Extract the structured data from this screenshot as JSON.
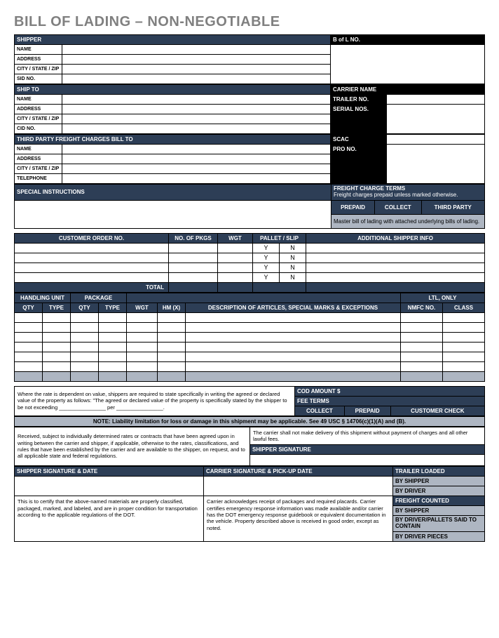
{
  "title": "BILL OF LADING – NON-NEGOTIABLE",
  "sections": {
    "shipper": {
      "header": "SHIPPER",
      "name": "NAME",
      "address": "ADDRESS",
      "csz": "CITY / STATE / ZIP",
      "sid": "SID NO."
    },
    "bol": {
      "header": "B of L NO."
    },
    "shipto": {
      "header": "SHIP TO",
      "name": "NAME",
      "address": "ADDRESS",
      "csz": "CITY / STATE / ZIP",
      "cid": "CID NO."
    },
    "carrier": {
      "name": "CARRIER NAME",
      "trailer": "TRAILER NO.",
      "serial": "SERIAL NOS."
    },
    "third": {
      "header": "THIRD PARTY FREIGHT CHARGES BILL TO",
      "name": "NAME",
      "address": "ADDRESS",
      "csz": "CITY / STATE / ZIP",
      "tel": "TELEPHONE"
    },
    "scac": "SCAC",
    "pro": "PRO NO.",
    "special": "SPECIAL INSTRUCTIONS",
    "freight": {
      "header": "FREIGHT CHARGE TERMS",
      "sub": "Freight charges prepaid unless marked otherwise.",
      "prepaid": "PREPAID",
      "collect": "COLLECT",
      "thirdparty": "THIRD PARTY",
      "master": "Master bill of lading with attached underlying bills of lading."
    }
  },
  "orderTable": {
    "custOrder": "CUSTOMER ORDER NO.",
    "pkgs": "NO. OF PKGS",
    "wgt": "WGT",
    "pallet": "PALLET / SLIP",
    "addl": "ADDITIONAL SHIPPER INFO",
    "y": "Y",
    "n": "N",
    "total": "TOTAL"
  },
  "handlingTable": {
    "hu": "HANDLING UNIT",
    "pkg": "PACKAGE",
    "ltl": "LTL, ONLY",
    "qty": "QTY",
    "type": "TYPE",
    "wgt": "WGT",
    "hm": "HM (X)",
    "desc": "DESCRIPTION OF ARTICLES, SPECIAL MARKS & EXCEPTIONS",
    "nmfc": "NMFC NO.",
    "class": "CLASS"
  },
  "valueNote": "Where the rate is dependent on value, shippers are required to state specifically in writing the agreed or declared value of the property as follows: \"The agreed or declared value of the property is specifically stated by the shipper to be not exceeding ________________ per ________________.",
  "cod": {
    "amount": "COD AMOUNT $",
    "feeTerms": "FEE TERMS",
    "collect": "COLLECT",
    "prepaid": "PREPAID",
    "check": "CUSTOMER CHECK"
  },
  "liability": "NOTE: Liability limitation for loss or damage in this shipment may be applicable. See 49 USC § 14706(c)(1)(A) and (B).",
  "received": "Received, subject to individually determined rates or contracts that have been agreed upon in writing between the carrier and shipper, if applicable, otherwise to the rates, classifications, and rules that have been established by the carrier and are available to the shipper, on request, and to all applicable state and federal regulations.",
  "carrierNoDeliver": "The carrier shall not make delivery of this shipment without payment of charges and all other lawful fees.",
  "shipperSig": "SHIPPER SIGNATURE",
  "sigDate": "SHIPPER SIGNATURE & DATE",
  "carrierSigDate": "CARRIER SIGNATURE & PICK-UP DATE",
  "trailerLoaded": "TRAILER LOADED",
  "byShipper": "BY SHIPPER",
  "byDriver": "BY DRIVER",
  "freightCounted": "FREIGHT COUNTED",
  "byDriverPallets": "BY DRIVER/PALLETS SAID TO CONTAIN",
  "byDriverPieces": "BY DRIVER PIECES",
  "certify": "This is to certify that the above-named materials are properly classified, packaged, marked, and labeled, and are in proper condition for transportation according to the applicable regulations of the DOT.",
  "carrierAck": "Carrier acknowledges receipt of packages and required placards. Carrier certifies emergency response information was made available and/or carrier has the DOT emergency response guidebook or equivalent documentation in the vehicle. Property described above is received in good order, except as noted."
}
